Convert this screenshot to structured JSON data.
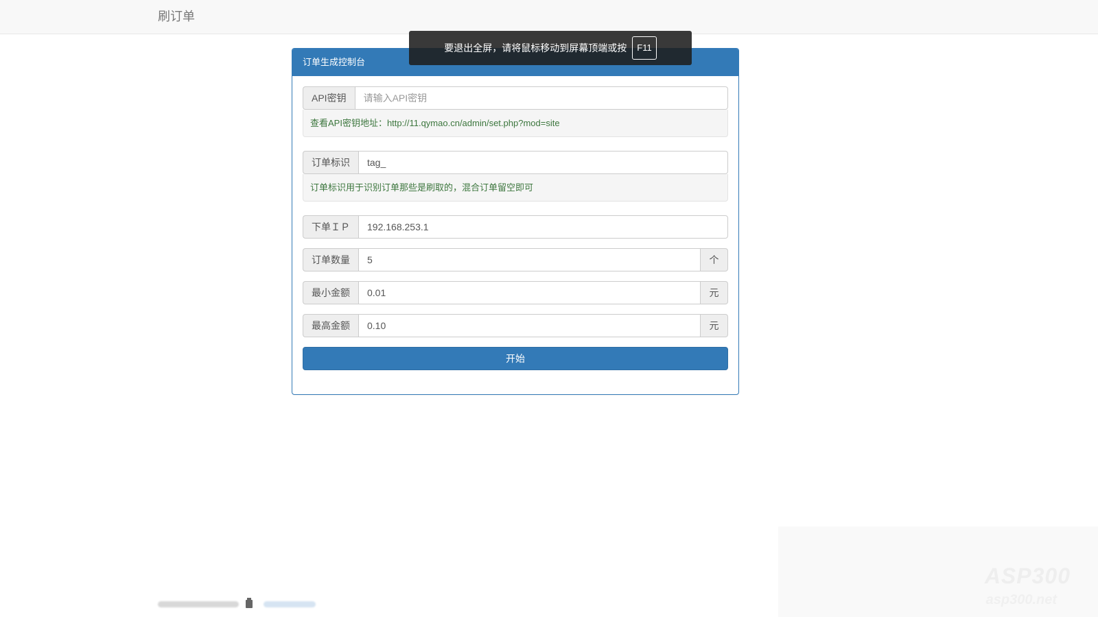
{
  "navbar": {
    "brand": "刷订单"
  },
  "fullscreen_notice": {
    "message": "要退出全屏，请将鼠标移动到屏幕顶端或按",
    "key": "F11"
  },
  "panel": {
    "title": "订单生成控制台",
    "api_key": {
      "label": "API密钥",
      "value": "",
      "placeholder": "请输入API密钥",
      "help": "查看API密钥地址：http://11.qymao.cn/admin/set.php?mod=site"
    },
    "order_tag": {
      "label": "订单标识",
      "value": "tag_",
      "help": "订单标识用于识别订单那些是刷取的，混合订单留空即可"
    },
    "order_ip": {
      "label": "下单ＩＰ",
      "value": "192.168.253.1"
    },
    "order_count": {
      "label": "订单数量",
      "value": "5",
      "unit": "个"
    },
    "min_amount": {
      "label": "最小金额",
      "value": "0.01",
      "unit": "元"
    },
    "max_amount": {
      "label": "最高金额",
      "value": "0.10",
      "unit": "元"
    },
    "start_button": "开始"
  },
  "watermark": {
    "text": "ASP300",
    "sub": "asp300.net"
  },
  "colors": {
    "primary": "#337ab7",
    "help_text": "#3c763d",
    "navbar_bg": "#f8f8f8"
  }
}
